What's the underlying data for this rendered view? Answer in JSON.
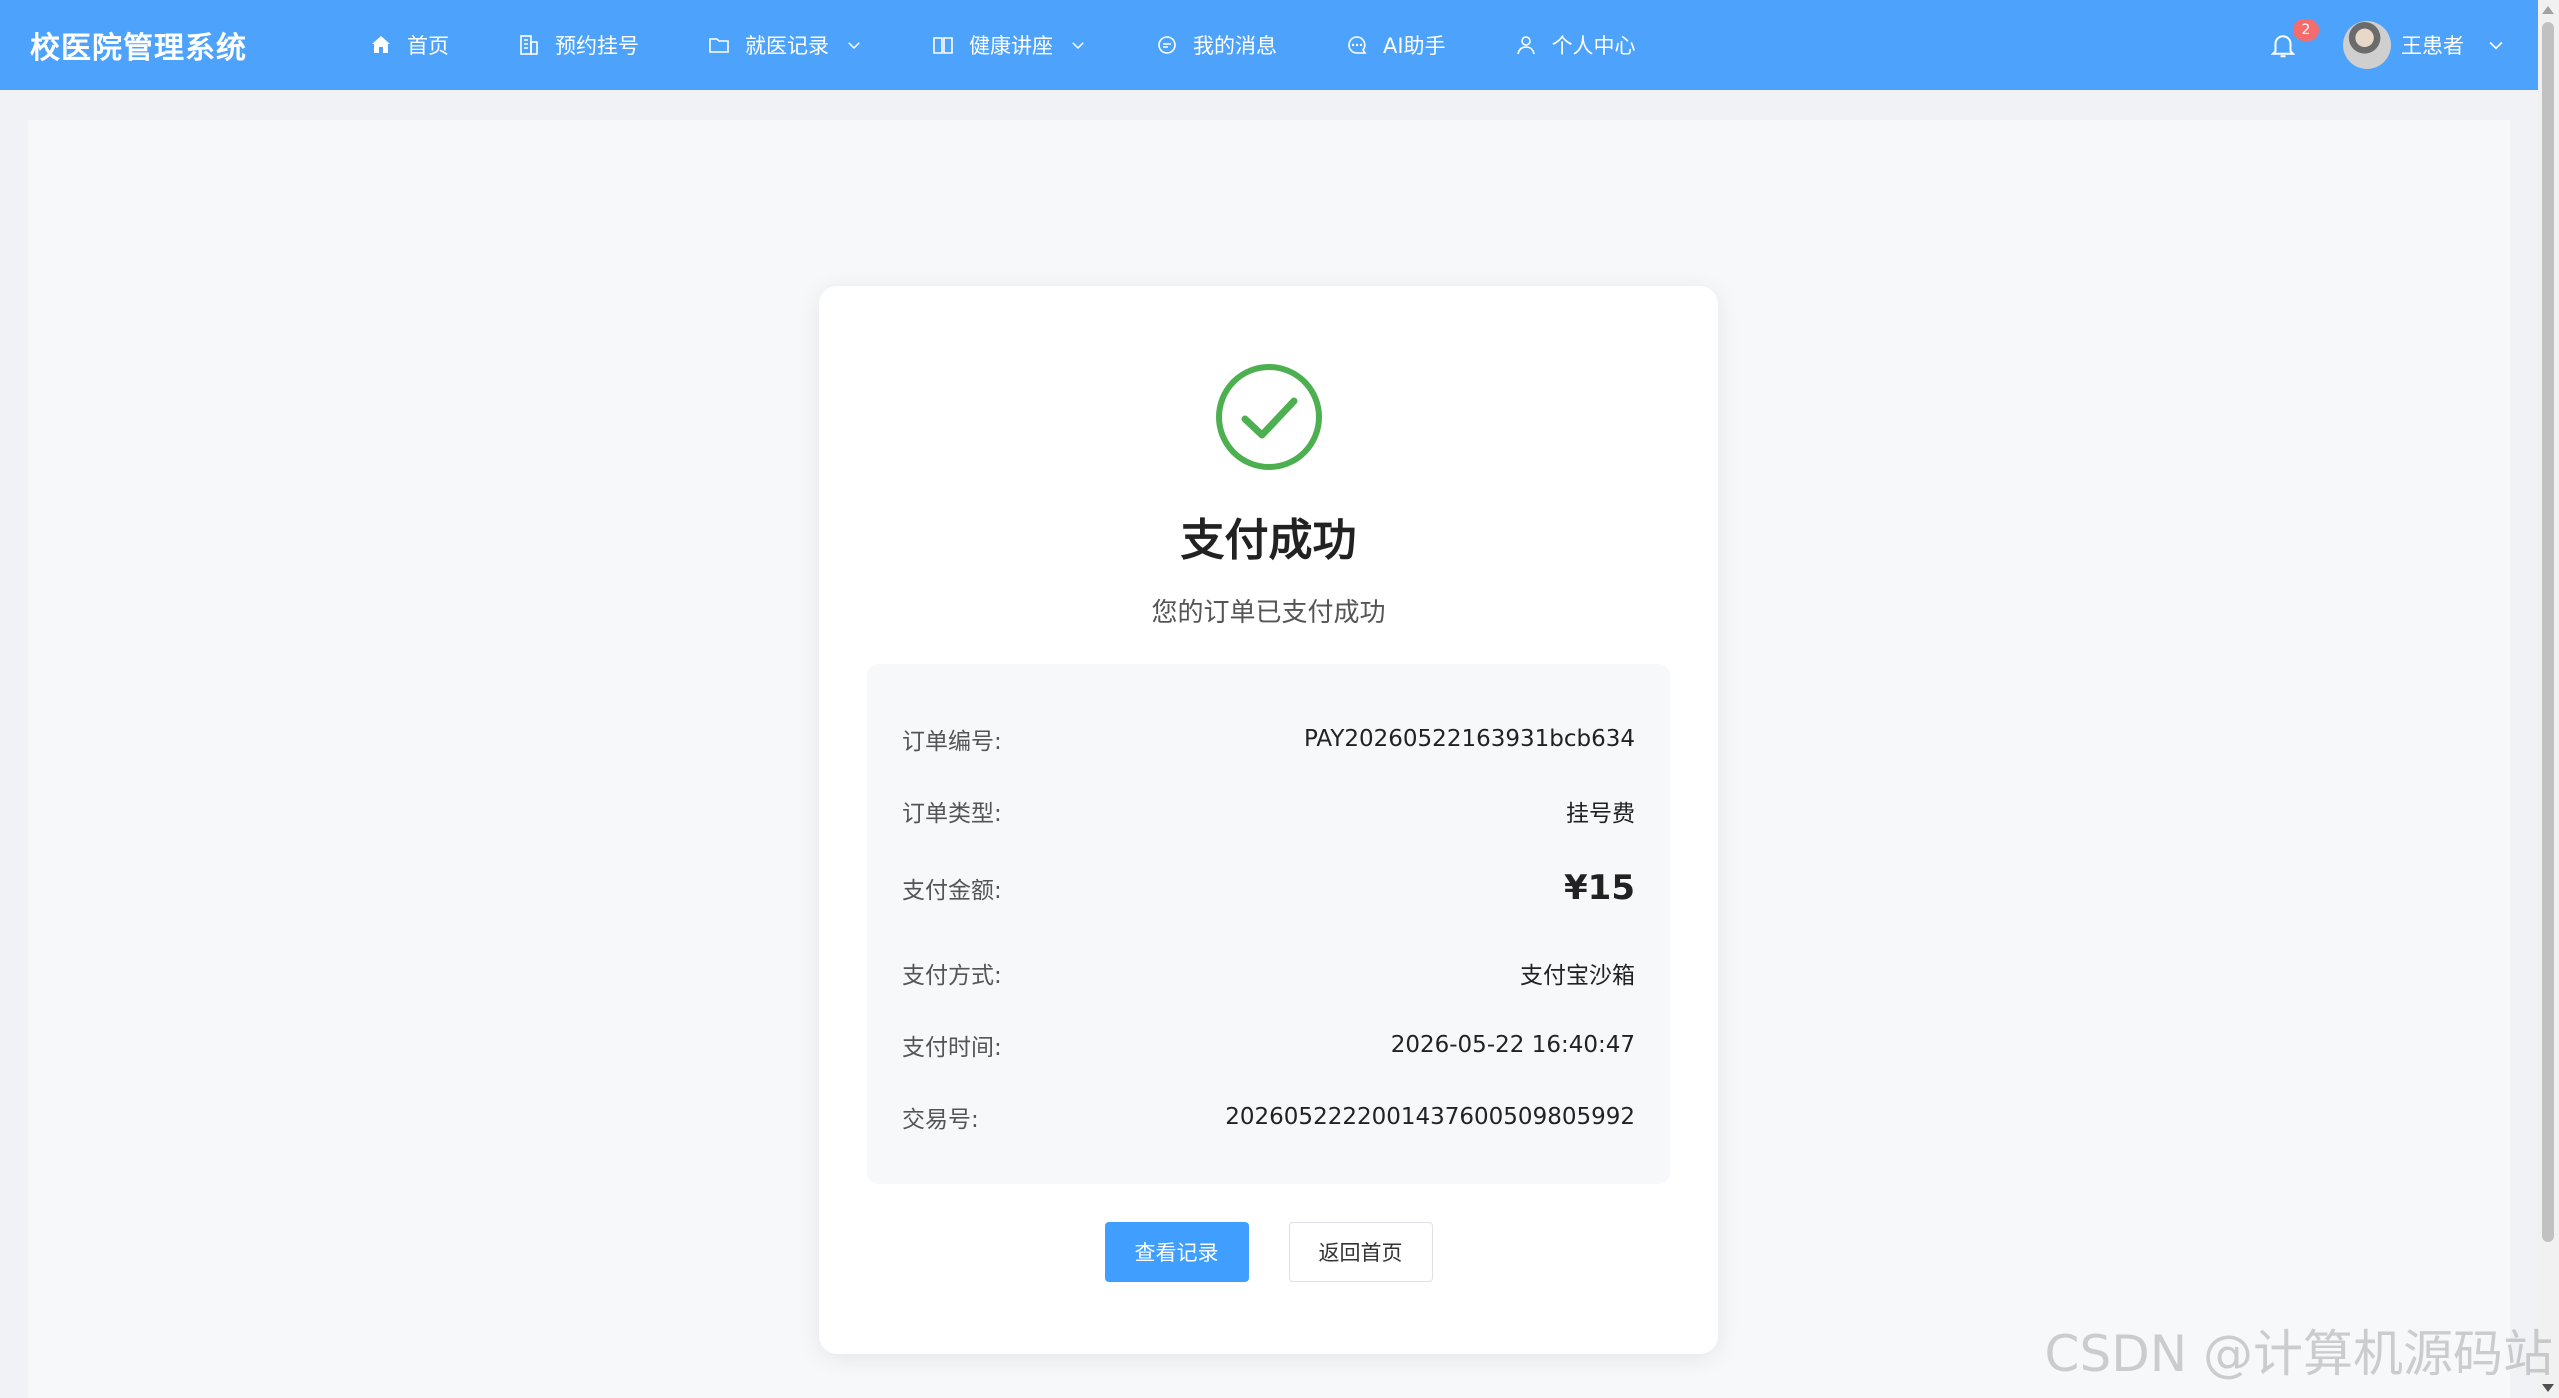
{
  "header": {
    "brand": "校医院管理系统",
    "nav": [
      {
        "label": "首页",
        "icon": "home-icon",
        "dropdown": false
      },
      {
        "label": "预约挂号",
        "icon": "building-icon",
        "dropdown": false
      },
      {
        "label": "就医记录",
        "icon": "folder-icon",
        "dropdown": true
      },
      {
        "label": "健康讲座",
        "icon": "book-icon",
        "dropdown": true
      },
      {
        "label": "我的消息",
        "icon": "chat-icon",
        "dropdown": false
      },
      {
        "label": "AI助手",
        "icon": "chat-dots-icon",
        "dropdown": false
      },
      {
        "label": "个人中心",
        "icon": "user-icon",
        "dropdown": false
      }
    ],
    "notification_count": "2",
    "user_name": "王患者"
  },
  "result": {
    "title": "支付成功",
    "subtitle": "您的订单已支付成功"
  },
  "order": {
    "rows": [
      {
        "label": "订单编号:",
        "value": "PAY20260522163931bcb634"
      },
      {
        "label": "订单类型:",
        "value": "挂号费"
      },
      {
        "label": "支付金额:",
        "value": "¥15"
      },
      {
        "label": "支付方式:",
        "value": "支付宝沙箱"
      },
      {
        "label": "支付时间:",
        "value": "2026-05-22 16:40:47"
      },
      {
        "label": "交易号:",
        "value": "2026052222001437600509805992"
      }
    ]
  },
  "actions": {
    "view_records": "查看记录",
    "back_home": "返回首页"
  },
  "watermark": "CSDN @计算机源码站",
  "colors": {
    "header_bg": "#4da3fb",
    "primary": "#409eff",
    "success": "#4caf50",
    "badge": "#f56c6c"
  }
}
